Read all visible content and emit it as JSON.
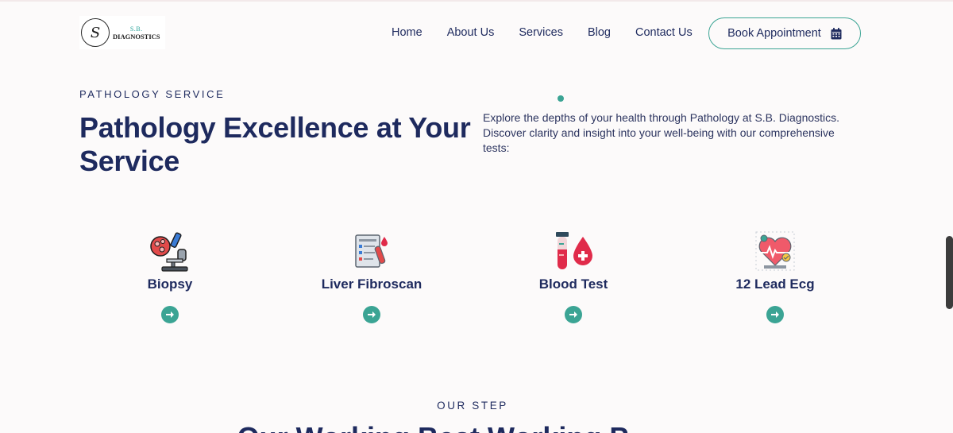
{
  "logo": {
    "monogram": "S",
    "line1": "S.B.",
    "line2": "DIAGNOSTICS"
  },
  "nav": {
    "items": [
      {
        "label": "Home"
      },
      {
        "label": "About Us"
      },
      {
        "label": "Services"
      },
      {
        "label": "Blog"
      },
      {
        "label": "Contact Us"
      }
    ],
    "cta_label": "Book Appointment",
    "cta_icon": "calendar-icon"
  },
  "hero": {
    "eyebrow": "PATHOLOGY SERVICE",
    "title": "Pathology Excellence at Your Service",
    "description": "Explore the depths of your health through Pathology at S.B. Diagnostics. Discover clarity and insight into your well-being with our comprehensive tests:"
  },
  "services": [
    {
      "label": "Biopsy",
      "icon": "microscope-icon"
    },
    {
      "label": "Liver Fibroscan",
      "icon": "clipboard-report-icon"
    },
    {
      "label": "Blood Test",
      "icon": "test-tube-blood-icon"
    },
    {
      "label": "12 Lead Ecg",
      "icon": "heart-ecg-icon"
    }
  ],
  "steps": {
    "eyebrow": "OUR STEP",
    "title": "Our Working Best Working P"
  },
  "colors": {
    "accent": "#3ba494",
    "navy": "#1e2a5e",
    "background": "#fcfafa"
  }
}
